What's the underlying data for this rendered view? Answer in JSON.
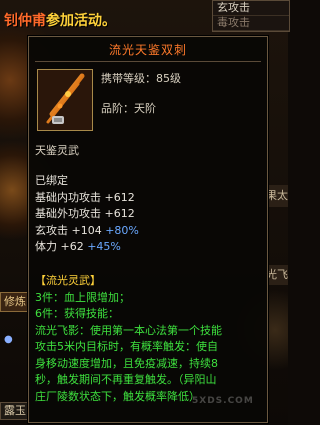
{
  "banner": {
    "prefix": "钊仲甫",
    "text": "参加活动。"
  },
  "right_panel": {
    "rows": [
      "玄攻击",
      "毒攻击"
    ]
  },
  "right_tabs": {
    "first": "果太",
    "second": "光飞"
  },
  "left_buttons": {
    "cultivate": "修炼",
    "bottom": "露玉"
  },
  "tooltip": {
    "title": "流光天鉴双刺",
    "item_icon": "twin-daggers-icon",
    "carry_level": "携带等级：85级",
    "grade": "品阶：天阶",
    "weapon_name": "天鉴灵武",
    "bound": "已绑定",
    "stats": [
      {
        "label": "基础内功攻击",
        "value": "+612",
        "bonus": ""
      },
      {
        "label": "基础外功攻击",
        "value": "+612",
        "bonus": ""
      },
      {
        "label": "玄攻击",
        "value": "+104",
        "bonus": "+80%"
      },
      {
        "label": "体力",
        "value": "+62",
        "bonus": "+45%"
      }
    ],
    "set_name": "【流光灵武】",
    "set_bonus_3": "3件：血上限增加；",
    "set_bonus_6": "6件：获得技能：",
    "skill_lines": [
      "流光飞影：使用第一本心法第一个技能",
      "攻击5米内目标时，有概率触发：使自",
      "身移动速度增加，且免疫减速，持续8",
      "秒，触发期间不再重复触发。（异阳山",
      "庄厂陵数状态下，触发概率降低）"
    ]
  },
  "watermark": {
    "url": "5XDS.COM"
  },
  "colors": {
    "title": "#ff7a2a",
    "bonus_blue": "#6aa8ff",
    "set_green": "#3ee03e",
    "set_name": "#ffd23a"
  }
}
